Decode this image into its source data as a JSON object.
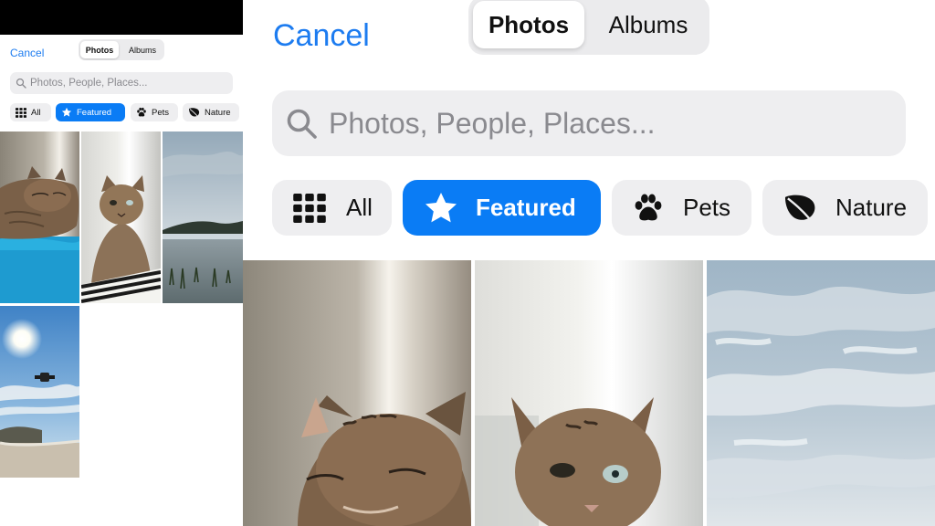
{
  "toolbar": {
    "cancel_label": "Cancel"
  },
  "segmented": {
    "photos_label": "Photos",
    "albums_label": "Albums",
    "selected": "Photos"
  },
  "search": {
    "placeholder": "Photos, People, Places..."
  },
  "filters": [
    {
      "label": "All",
      "icon": "grid-icon",
      "selected": false
    },
    {
      "label": "Featured",
      "icon": "star-icon",
      "selected": true
    },
    {
      "label": "Pets",
      "icon": "paw-icon",
      "selected": false
    },
    {
      "label": "Nature",
      "icon": "leaf-icon",
      "selected": false
    }
  ],
  "colors": {
    "accent": "#0a7cf5",
    "chip_bg": "#eeeef0",
    "link": "#1d7cf0"
  }
}
